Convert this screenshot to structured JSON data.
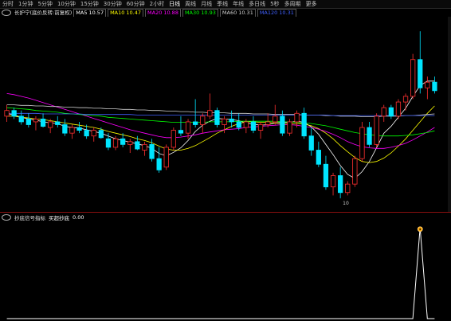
{
  "tabs": [
    "分时",
    "1分钟",
    "5分钟",
    "10分钟",
    "15分钟",
    "30分钟",
    "60分钟",
    "2小时",
    "日线",
    "周线",
    "月线",
    "季线",
    "年线",
    "多日线",
    "5秒",
    "多周期",
    "更多"
  ],
  "active_tab": "日线",
  "ma_legend": {
    "title": "长护宁(底价反转:前复权)",
    "items": [
      {
        "label": "MA5",
        "value": "10.57",
        "color": "#ffffff"
      },
      {
        "label": "MA10",
        "value": "10.47",
        "color": "#ffff00"
      },
      {
        "label": "MA20",
        "value": "10.88",
        "color": "#ff00ff"
      },
      {
        "label": "MA30",
        "value": "10.93",
        "color": "#00ff00"
      },
      {
        "label": "MA60",
        "value": "10.31",
        "color": "#cfcfcf"
      },
      {
        "label": "MA120",
        "value": "10.31",
        "color": "#4060ff"
      }
    ]
  },
  "indicator_legend": {
    "title": "抄底信号指标",
    "label": "买超抄底",
    "value": "0.00"
  },
  "price_labels": {
    "low_mark": "10"
  },
  "colors": {
    "up": "#ff3030",
    "down": "#00e5ff",
    "background": "#000000",
    "divider": "#8a1010",
    "signal": "#ffa500"
  },
  "chart_data": {
    "type": "candlestick",
    "candles": [
      [
        10.9,
        11.1,
        10.8,
        11.0
      ],
      [
        11.0,
        11.05,
        10.85,
        10.9
      ],
      [
        10.9,
        11.0,
        10.75,
        10.8
      ],
      [
        10.85,
        10.95,
        10.7,
        10.75
      ],
      [
        10.8,
        10.9,
        10.65,
        10.85
      ],
      [
        10.85,
        10.95,
        10.7,
        10.72
      ],
      [
        10.7,
        10.85,
        10.6,
        10.8
      ],
      [
        10.8,
        10.9,
        10.7,
        10.75
      ],
      [
        10.75,
        10.85,
        10.55,
        10.6
      ],
      [
        10.6,
        10.75,
        10.5,
        10.7
      ],
      [
        10.7,
        10.8,
        10.6,
        10.65
      ],
      [
        10.65,
        10.75,
        10.5,
        10.55
      ],
      [
        10.55,
        10.7,
        10.45,
        10.65
      ],
      [
        10.65,
        10.7,
        10.5,
        10.52
      ],
      [
        10.5,
        10.6,
        10.3,
        10.35
      ],
      [
        10.35,
        10.55,
        10.3,
        10.5
      ],
      [
        10.5,
        10.6,
        10.35,
        10.4
      ],
      [
        10.4,
        10.5,
        10.25,
        10.45
      ],
      [
        10.45,
        10.55,
        10.3,
        10.32
      ],
      [
        10.3,
        10.45,
        10.2,
        10.4
      ],
      [
        10.4,
        10.5,
        10.1,
        10.15
      ],
      [
        10.15,
        10.35,
        9.9,
        9.95
      ],
      [
        10.0,
        10.4,
        9.95,
        10.35
      ],
      [
        10.35,
        10.7,
        10.3,
        10.65
      ],
      [
        10.65,
        10.9,
        10.55,
        10.6
      ],
      [
        10.6,
        10.85,
        10.5,
        10.8
      ],
      [
        10.8,
        11.2,
        10.7,
        10.75
      ],
      [
        10.75,
        10.95,
        10.6,
        10.9
      ],
      [
        10.9,
        11.3,
        10.85,
        11.0
      ],
      [
        11.0,
        11.05,
        10.7,
        10.75
      ],
      [
        10.75,
        10.9,
        10.6,
        10.85
      ],
      [
        10.85,
        11.0,
        10.7,
        10.8
      ],
      [
        10.8,
        10.95,
        10.65,
        10.7
      ],
      [
        10.7,
        10.85,
        10.6,
        10.8
      ],
      [
        10.8,
        10.9,
        10.6,
        10.65
      ],
      [
        10.65,
        10.8,
        10.5,
        10.75
      ],
      [
        10.75,
        10.95,
        10.7,
        10.8
      ],
      [
        10.8,
        11.1,
        10.75,
        10.9
      ],
      [
        10.9,
        11.0,
        10.55,
        10.6
      ],
      [
        10.6,
        10.85,
        10.55,
        10.8
      ],
      [
        10.8,
        11.0,
        10.7,
        10.95
      ],
      [
        10.95,
        11.05,
        10.5,
        10.55
      ],
      [
        10.55,
        10.7,
        10.2,
        10.3
      ],
      [
        10.3,
        10.45,
        10.0,
        10.05
      ],
      [
        10.05,
        10.2,
        9.6,
        9.65
      ],
      [
        9.65,
        9.9,
        9.5,
        9.85
      ],
      [
        9.85,
        10.0,
        9.45,
        9.55
      ],
      [
        9.55,
        9.75,
        9.5,
        9.7
      ],
      [
        9.7,
        10.2,
        9.65,
        10.15
      ],
      [
        10.15,
        10.8,
        10.1,
        10.7
      ],
      [
        10.7,
        10.8,
        10.35,
        10.4
      ],
      [
        10.4,
        10.95,
        10.35,
        10.9
      ],
      [
        10.9,
        11.1,
        10.8,
        11.05
      ],
      [
        11.05,
        11.1,
        10.85,
        10.9
      ],
      [
        10.9,
        11.2,
        10.85,
        11.15
      ],
      [
        11.15,
        11.3,
        11.0,
        11.25
      ],
      [
        11.25,
        12.0,
        11.2,
        11.9
      ],
      [
        11.9,
        12.4,
        11.3,
        11.4
      ],
      [
        11.4,
        11.6,
        11.2,
        11.5
      ],
      [
        11.5,
        11.6,
        11.3,
        11.35
      ]
    ],
    "ma_series": [
      {
        "name": "MA5",
        "color": "#ffffff",
        "values": [
          10.95,
          10.92,
          10.88,
          10.85,
          10.83,
          10.8,
          10.78,
          10.77,
          10.72,
          10.7,
          10.69,
          10.66,
          10.63,
          10.6,
          10.55,
          10.5,
          10.47,
          10.44,
          10.41,
          10.38,
          10.33,
          10.24,
          10.2,
          10.26,
          10.34,
          10.47,
          10.63,
          10.74,
          10.81,
          10.86,
          10.85,
          10.84,
          10.82,
          10.78,
          10.76,
          10.74,
          10.75,
          10.78,
          10.79,
          10.79,
          10.81,
          10.79,
          10.71,
          10.58,
          10.4,
          10.22,
          10.03,
          9.87,
          9.8,
          9.92,
          10.1,
          10.34,
          10.6,
          10.72,
          10.88,
          11.04,
          11.25,
          11.44,
          11.52,
          11.52
        ]
      },
      {
        "name": "MA10",
        "color": "#ffff00",
        "values": [
          10.9,
          10.9,
          10.88,
          10.87,
          10.85,
          10.84,
          10.82,
          10.8,
          10.78,
          10.76,
          10.74,
          10.72,
          10.7,
          10.67,
          10.63,
          10.6,
          10.57,
          10.54,
          10.5,
          10.47,
          10.43,
          10.37,
          10.32,
          10.3,
          10.3,
          10.33,
          10.38,
          10.45,
          10.52,
          10.6,
          10.66,
          10.72,
          10.77,
          10.8,
          10.8,
          10.79,
          10.79,
          10.78,
          10.77,
          10.77,
          10.77,
          10.76,
          10.73,
          10.68,
          10.6,
          10.5,
          10.38,
          10.27,
          10.17,
          10.1,
          10.08,
          10.1,
          10.16,
          10.25,
          10.37,
          10.5,
          10.65,
          10.8,
          10.95,
          11.08
        ]
      },
      {
        "name": "MA20",
        "color": "#ff00ff",
        "values": [
          11.3,
          11.28,
          11.25,
          11.22,
          11.18,
          11.14,
          11.1,
          11.06,
          11.02,
          10.98,
          10.94,
          10.9,
          10.86,
          10.82,
          10.78,
          10.74,
          10.7,
          10.66,
          10.63,
          10.6,
          10.57,
          10.54,
          10.52,
          10.52,
          10.53,
          10.55,
          10.57,
          10.6,
          10.62,
          10.64,
          10.66,
          10.67,
          10.68,
          10.7,
          10.71,
          10.72,
          10.73,
          10.74,
          10.75,
          10.75,
          10.74,
          10.72,
          10.7,
          10.67,
          10.63,
          10.58,
          10.52,
          10.45,
          10.4,
          10.36,
          10.34,
          10.33,
          10.33,
          10.35,
          10.38,
          10.42,
          10.48,
          10.55,
          10.62,
          10.7
        ]
      },
      {
        "name": "MA30",
        "color": "#00ff00",
        "values": [
          11.05,
          11.04,
          11.03,
          11.02,
          11.0,
          10.99,
          10.98,
          10.97,
          10.95,
          10.94,
          10.93,
          10.92,
          10.91,
          10.9,
          10.88,
          10.87,
          10.86,
          10.85,
          10.84,
          10.83,
          10.82,
          10.81,
          10.8,
          10.79,
          10.79,
          10.79,
          10.79,
          10.79,
          10.8,
          10.8,
          10.8,
          10.8,
          10.81,
          10.81,
          10.81,
          10.81,
          10.81,
          10.81,
          10.8,
          10.8,
          10.79,
          10.78,
          10.77,
          10.75,
          10.73,
          10.7,
          10.67,
          10.64,
          10.61,
          10.59,
          10.57,
          10.56,
          10.55,
          10.55,
          10.55,
          10.56,
          10.57,
          10.59,
          10.61,
          10.64
        ]
      },
      {
        "name": "MA60",
        "color": "#cfcfcf",
        "values": [
          11.1,
          11.1,
          11.09,
          11.09,
          11.08,
          11.08,
          11.07,
          11.07,
          11.06,
          11.06,
          11.05,
          11.05,
          11.04,
          11.04,
          11.03,
          11.03,
          11.02,
          11.02,
          11.01,
          11.01,
          11.0,
          11.0,
          10.99,
          10.99,
          10.98,
          10.98,
          10.97,
          10.97,
          10.96,
          10.96,
          10.96,
          10.95,
          10.95,
          10.95,
          10.94,
          10.94,
          10.94,
          10.93,
          10.93,
          10.93,
          10.93,
          10.92,
          10.92,
          10.92,
          10.91,
          10.91,
          10.9,
          10.9,
          10.9,
          10.89,
          10.89,
          10.89,
          10.9,
          10.9,
          10.9,
          10.91,
          10.91,
          10.92,
          10.93,
          10.94
        ]
      },
      {
        "name": "MA120",
        "color": "#4060ff",
        "values": [
          10.95,
          10.95,
          10.95,
          10.95,
          10.95,
          10.94,
          10.94,
          10.94,
          10.94,
          10.94,
          10.94,
          10.93,
          10.93,
          10.93,
          10.93,
          10.93,
          10.93,
          10.93,
          10.92,
          10.92,
          10.92,
          10.92,
          10.92,
          10.92,
          10.92,
          10.92,
          10.92,
          10.92,
          10.92,
          10.92,
          10.92,
          10.92,
          10.92,
          10.92,
          10.92,
          10.92,
          10.92,
          10.92,
          10.92,
          10.92,
          10.92,
          10.92,
          10.92,
          10.92,
          10.92,
          10.91,
          10.91,
          10.91,
          10.91,
          10.91,
          10.91,
          10.91,
          10.91,
          10.91,
          10.91,
          10.91,
          10.91,
          10.91,
          10.91,
          10.91
        ]
      }
    ],
    "ylim": [
      9.35,
      12.6
    ],
    "indicator": {
      "name": "买超抄底",
      "values": [
        0,
        0,
        0,
        0,
        0,
        0,
        0,
        0,
        0,
        0,
        0,
        0,
        0,
        0,
        0,
        0,
        0,
        0,
        0,
        0,
        0,
        0,
        0,
        0,
        0,
        0,
        0,
        0,
        0,
        0,
        0,
        0,
        0,
        0,
        0,
        0,
        0,
        0,
        0,
        0,
        0,
        0,
        0,
        0,
        0,
        0,
        0,
        0,
        0,
        0,
        0,
        0,
        0,
        0,
        0,
        0,
        0,
        1,
        0,
        0
      ],
      "ylim": [
        0,
        1.05
      ]
    }
  }
}
